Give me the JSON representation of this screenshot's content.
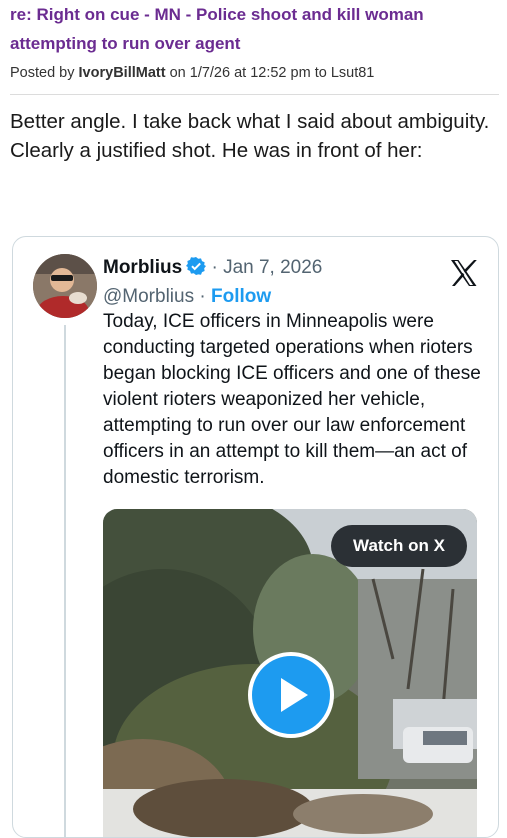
{
  "post": {
    "title": "re: Right on cue - MN - Police shoot and kill woman attempting to run over agent",
    "posted_by_prefix": "Posted by",
    "author": "IvoryBillMatt",
    "on_word": "on",
    "datetime": "1/7/26 at 12:52 pm",
    "to_word": "to",
    "recipient": "Lsut81",
    "body": "Better angle. I take back what I said about ambiguity. Clearly a justified shot. He was in front of her:"
  },
  "tweet": {
    "display_name": "Morblius",
    "date": "Jan 7, 2026",
    "handle": "@Morblius",
    "follow_label": "Follow",
    "text": "Today, ICE officers in Minneapolis were conducting targeted operations when rioters began blocking ICE officers and one of these violent rioters weaponized her vehicle, attempting to run over our law enforcement officers in an attempt to kill them—an act of domestic terrorism.",
    "watch_label": "Watch on X"
  },
  "colors": {
    "link_purple": "#6b2c91",
    "x_blue": "#1d9bf0",
    "muted_gray": "#536471"
  },
  "icons": [
    "verified-badge-icon",
    "x-logo-icon",
    "play-icon"
  ]
}
